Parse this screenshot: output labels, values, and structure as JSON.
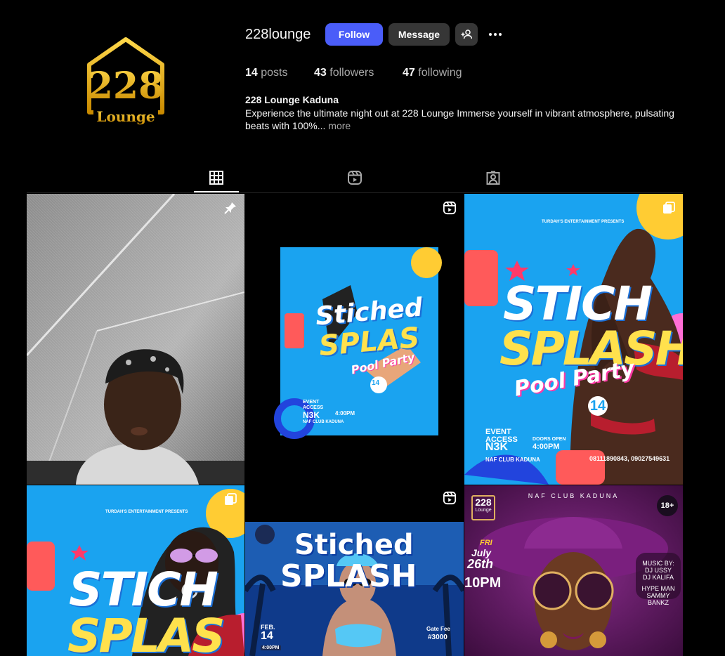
{
  "profile": {
    "username": "228lounge",
    "logo_text": "228",
    "logo_sub": "Lounge",
    "buttons": {
      "follow": "Follow",
      "message": "Message"
    },
    "stats": {
      "posts_count": "14",
      "posts_label": "posts",
      "followers_count": "43",
      "followers_label": "followers",
      "following_count": "47",
      "following_label": "following"
    },
    "full_name": "228 Lounge Kaduna",
    "bio": "Experience the ultimate night out at 228 Lounge Immerse yourself in vibrant atmosphere, pulsating beats with 100%...",
    "bio_more": "more"
  },
  "tabs": [
    {
      "icon": "grid-icon",
      "active": true
    },
    {
      "icon": "reels-icon",
      "active": false
    },
    {
      "icon": "tagged-icon",
      "active": false
    }
  ],
  "posts": [
    {
      "type": "photo",
      "pinned": true,
      "icon": "pin-icon"
    },
    {
      "type": "reel",
      "icon": "reels-icon",
      "title_1": "Stiched",
      "title_2": "SPLAS",
      "subtitle": "Pool Party",
      "price_label": "EVENT ACCESS",
      "price": "N3K",
      "time": "4:00PM",
      "venue": "NAF CLUB KADUNA",
      "date_num": "14"
    },
    {
      "type": "carousel",
      "icon": "carousel-icon",
      "presenter": "TURDAH'S ENTERTAINMENT PRESENTS",
      "title_1": "STICH",
      "title_2": "SPLASH",
      "subtitle": "Pool Party",
      "date_num": "14",
      "price_label": "EVENT ACCESS",
      "price": "N3K",
      "doors_label": "DOORS OPEN",
      "doors_time": "4:00PM",
      "venue": "NAF CLUB KADUNA",
      "phones": "08111890843, 09027549631"
    },
    {
      "type": "carousel",
      "icon": "carousel-icon",
      "presenter": "TURDAH'S ENTERTAINMENT PRESENTS",
      "title_1": "STICH",
      "title_2": "SPLAS"
    },
    {
      "type": "reel",
      "icon": "reels-icon",
      "title_1": "Stiched",
      "title_2": "SPLASH",
      "date_month": "FEB.",
      "date_num": "14",
      "time": "4:00PM",
      "gate_label": "Gate Fee",
      "gate_fee": "#3000"
    },
    {
      "type": "photo",
      "header": "NAF CLUB KADUNA",
      "logo_text": "228",
      "logo_sub": "Lounge",
      "age": "18+",
      "day": "FRI",
      "date_line1": "July",
      "date_line2": "26th",
      "time": "10PM",
      "music_label": "MUSIC BY:",
      "dj1": "DJ USSY",
      "dj2": "DJ KALIFA",
      "hype_label": "HYPE MAN",
      "hype_name": "SAMMY BANKZ"
    }
  ],
  "colors": {
    "accent": "#4a5df9",
    "button_dark": "#363636",
    "gold": "#f2b705",
    "poster_blue": "#1aa3f0"
  }
}
